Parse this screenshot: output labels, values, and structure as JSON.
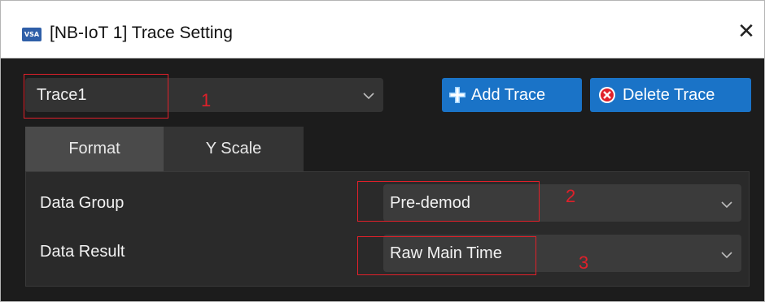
{
  "window": {
    "app_icon_text": "VSA",
    "title": "[NB-IoT 1] Trace Setting",
    "close_glyph": "✕"
  },
  "trace": {
    "selected": "Trace1",
    "add_label": "Add Trace",
    "delete_label": "Delete Trace"
  },
  "tabs": [
    {
      "label": "Format",
      "active": true
    },
    {
      "label": "Y Scale",
      "active": false
    }
  ],
  "format": {
    "data_group_label": "Data Group",
    "data_group_value": "Pre-demod",
    "data_result_label": "Data Result",
    "data_result_value": "Raw Main Time"
  },
  "annotations": [
    "1",
    "2",
    "3"
  ],
  "colors": {
    "accent": "#1a73c7",
    "annotation": "#e0202a",
    "window_bg": "#1c1c1c",
    "delete_icon": "#e0202a"
  },
  "icons": {
    "app": "vsa-app-icon",
    "add": "plus-icon",
    "delete": "delete-circle-icon",
    "dropdown": "chevron-down-icon",
    "close": "close-icon"
  }
}
